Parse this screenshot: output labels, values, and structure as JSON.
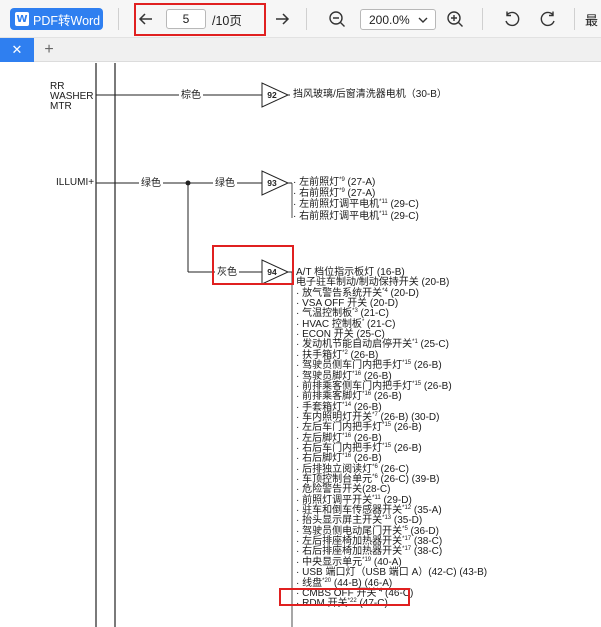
{
  "toolbar": {
    "pdf_to_word_label": "PDF转Word",
    "page_current": "5",
    "page_total": "/10页",
    "zoom_value": "200.0%",
    "cut_label": "最"
  },
  "tabs": {
    "close_glyph": "✕",
    "add_glyph": "+"
  },
  "doc": {
    "top_source": [
      "RR",
      "WASHER",
      "MTR"
    ],
    "top_wire_color": "棕色",
    "top_connector": "92",
    "top_target": "挡风玻璃/后窗清洗器电机（30-B）",
    "illumi_label": "ILLUMI+",
    "green1": "绿色",
    "green2": "绿色",
    "gray": "灰色",
    "conn93": "93",
    "conn94": "94",
    "list93": [
      {
        "t": "左前照灯",
        "s": "*9",
        "r": " (27-A)"
      },
      {
        "t": "右前照灯",
        "s": "*9",
        "r": " (27-A)"
      },
      {
        "t": "左前照灯调平电机",
        "s": "*11",
        "r": " (29-C)"
      },
      {
        "t": "右前照灯调平电机",
        "s": "*11",
        "r": " (29-C)"
      }
    ],
    "list94": [
      {
        "t": "A/T 档位指示板灯 (16-B)",
        "s": "",
        "r": ""
      },
      {
        "t": "电子驻车制动/制动保持开关 (20-B)",
        "s": "",
        "r": ""
      },
      {
        "t": "· 放气警告系统开关",
        "s": "*4",
        "r": " (20-D)"
      },
      {
        "t": "· VSA OFF 开关 (20-D)",
        "s": "",
        "r": ""
      },
      {
        "t": "· 气温控制板",
        "s": "*3",
        "r": " (21-C)"
      },
      {
        "t": "· HVAC 控制板",
        "s": "*",
        "r": " (21-C)"
      },
      {
        "t": "· ECON 开关 (25-C)",
        "s": "",
        "r": ""
      },
      {
        "t": "· 发动机节能自动启停开关",
        "s": "*1",
        "r": " (25-C)"
      },
      {
        "t": "· 扶手箱灯",
        "s": "*2",
        "r": " (26-B)"
      },
      {
        "t": "· 驾驶员侧车门内把手灯",
        "s": "*15",
        "r": " (26-B)"
      },
      {
        "t": "· 驾驶员脚灯",
        "s": "*16",
        "r": " (26-B)"
      },
      {
        "t": "· 前排乘客侧车门内把手灯",
        "s": "*15",
        "r": " (26-B)"
      },
      {
        "t": "· 前排乘客脚灯",
        "s": "*16",
        "r": " (26-B)"
      },
      {
        "t": "· 手套箱灯",
        "s": "*14",
        "r": " (26-B)"
      },
      {
        "t": "· 车内照明灯开关",
        "s": "*7",
        "r": " (26-B) (30-D)"
      },
      {
        "t": "· 左后车门内把手灯",
        "s": "*15",
        "r": " (26-B)"
      },
      {
        "t": "· 左后脚灯",
        "s": "*16",
        "r": " (26-B)"
      },
      {
        "t": "· 右后车门内把手灯",
        "s": "*15",
        "r": " (26-B)"
      },
      {
        "t": "· 右后脚灯",
        "s": "*16",
        "r": " (26-B)"
      },
      {
        "t": "· 后排独立阅读灯",
        "s": "*6",
        "r": " (26-C)"
      },
      {
        "t": "· 车顶控制台单元",
        "s": "*6",
        "r": " (26-C) (39-B)"
      },
      {
        "t": "· 危险警告开关(28-C)",
        "s": "",
        "r": ""
      },
      {
        "t": "· 前照灯调平开关",
        "s": "*11",
        "r": " (29-D)"
      },
      {
        "t": "· 驻车和倒车传感器开关",
        "s": "*12",
        "r": " (35-A)"
      },
      {
        "t": "· 抬头显示屏主开关",
        "s": "*13",
        "r": " (35-D)"
      },
      {
        "t": "· 驾驶员侧电动尾门开关",
        "s": "*5",
        "r": " (36-D)"
      },
      {
        "t": "· 左后排座椅加热器开关",
        "s": "*17",
        "r": " (38-C)"
      },
      {
        "t": "· 右后排座椅加热器开关",
        "s": "*17",
        "r": " (38-C)"
      },
      {
        "t": "· 中央显示单元",
        "s": "*19",
        "r": " (40-A)"
      },
      {
        "t": "· USB 端口灯（USB 端口 A）(42-C) (43-B)",
        "s": "",
        "r": ""
      },
      {
        "t": "· 线盘",
        "s": "*20",
        "r": " (44-B) (46-A)"
      },
      {
        "t": "· CMBS OFF 开关",
        "s": "*4",
        "r": " (46-C)"
      },
      {
        "t": "· RDM 开关",
        "s": "*22",
        "r": " (47-C)"
      }
    ]
  }
}
